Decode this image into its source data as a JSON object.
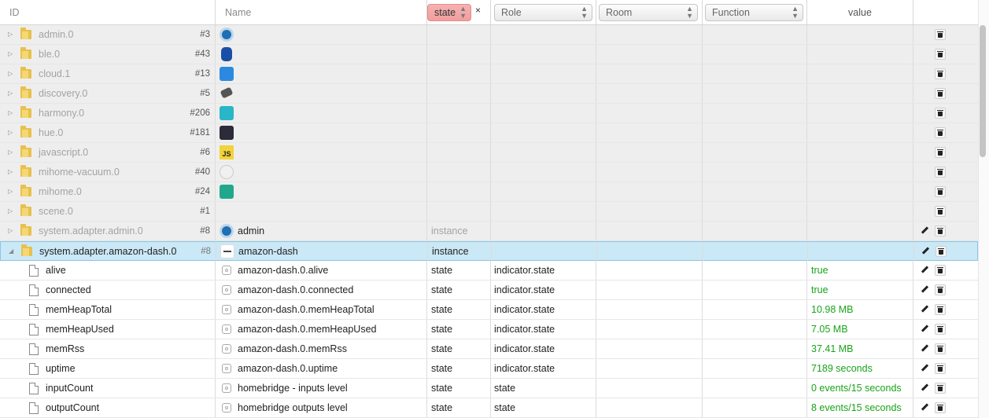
{
  "header": {
    "id_label": "ID",
    "name_label": "Name",
    "type_filter": "state",
    "role_filter": "Role",
    "room_filter": "Room",
    "function_filter": "Function",
    "value_label": "value",
    "clear_filter_icon": "×"
  },
  "instances": [
    {
      "id": "admin.0",
      "num": "#3",
      "icon": "admin-icon",
      "name": "",
      "type": ""
    },
    {
      "id": "ble.0",
      "num": "#43",
      "icon": "bluetooth-icon",
      "name": "",
      "type": ""
    },
    {
      "id": "cloud.1",
      "num": "#13",
      "icon": "cloud-icon",
      "name": "",
      "type": ""
    },
    {
      "id": "discovery.0",
      "num": "#5",
      "icon": "binoculars-icon",
      "name": "",
      "type": ""
    },
    {
      "id": "harmony.0",
      "num": "#206",
      "icon": "harmony-icon",
      "name": "",
      "type": ""
    },
    {
      "id": "hue.0",
      "num": "#181",
      "icon": "hue-icon",
      "name": "",
      "type": ""
    },
    {
      "id": "javascript.0",
      "num": "#6",
      "icon": "javascript-icon",
      "name": "",
      "type": ""
    },
    {
      "id": "mihome-vacuum.0",
      "num": "#40",
      "icon": "vacuum-icon",
      "name": "",
      "type": ""
    },
    {
      "id": "mihome.0",
      "num": "#24",
      "icon": "mihome-icon",
      "name": "",
      "type": ""
    },
    {
      "id": "scene.0",
      "num": "#1",
      "icon": "",
      "name": "",
      "type": ""
    },
    {
      "id": "system.adapter.admin.0",
      "num": "#8",
      "icon": "admin-icon",
      "name": "admin",
      "type": "instance"
    },
    {
      "id": "system.adapter.amazon-dash.0",
      "num": "#8",
      "icon": "amazon-dash-icon",
      "name": "amazon-dash",
      "type": "instance"
    }
  ],
  "states": [
    {
      "id": "alive",
      "name": "amazon-dash.0.alive",
      "type": "state",
      "role": "indicator.state",
      "value": "true"
    },
    {
      "id": "connected",
      "name": "amazon-dash.0.connected",
      "type": "state",
      "role": "indicator.state",
      "value": "true"
    },
    {
      "id": "memHeapTotal",
      "name": "amazon-dash.0.memHeapTotal",
      "type": "state",
      "role": "indicator.state",
      "value": "10.98 MB"
    },
    {
      "id": "memHeapUsed",
      "name": "amazon-dash.0.memHeapUsed",
      "type": "state",
      "role": "indicator.state",
      "value": "7.05 MB"
    },
    {
      "id": "memRss",
      "name": "amazon-dash.0.memRss",
      "type": "state",
      "role": "indicator.state",
      "value": "37.41 MB"
    },
    {
      "id": "uptime",
      "name": "amazon-dash.0.uptime",
      "type": "state",
      "role": "indicator.state",
      "value": "7189 seconds"
    },
    {
      "id": "inputCount",
      "name": "homebridge - inputs level",
      "type": "state",
      "role": "state",
      "value": "0 events/15 seconds"
    },
    {
      "id": "outputCount",
      "name": "homebridge outputs level",
      "type": "state",
      "role": "state",
      "value": "8 events/15 seconds"
    }
  ],
  "colors": {
    "value_green": "#1aa31a",
    "selected_row": "#cbe8f6",
    "active_filter": "#f19d9d",
    "folder": "#e7c14e"
  }
}
